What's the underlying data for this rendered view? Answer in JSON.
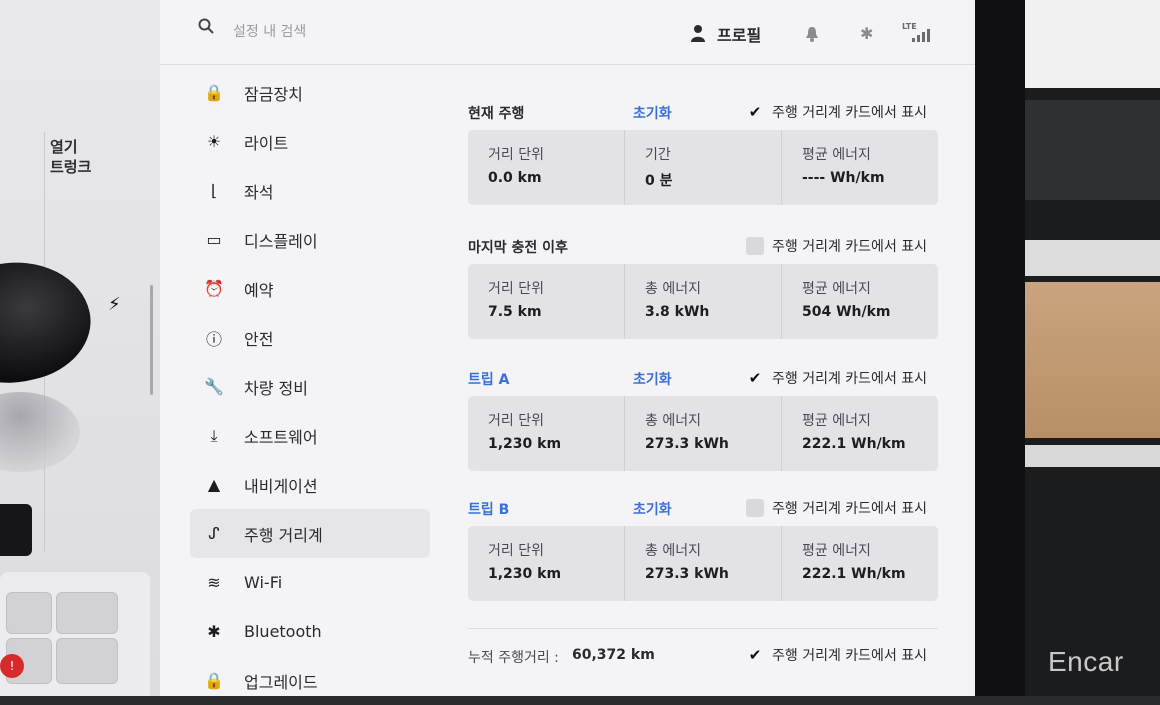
{
  "car_panel": {
    "trunk_label_line1": "열기",
    "trunk_label_line2": "트렁크",
    "seat_warning_icon": "!"
  },
  "header": {
    "search_placeholder": "설정 내 검색",
    "profile_label": "프로필",
    "lte_label": "LTE"
  },
  "sidebar": {
    "items": [
      {
        "label": "잠금장치",
        "icon": "lock-icon",
        "glyph": "🔒"
      },
      {
        "label": "라이트",
        "icon": "light-icon",
        "glyph": "☀"
      },
      {
        "label": "좌석",
        "icon": "seat-icon",
        "glyph": "⌊"
      },
      {
        "label": "디스플레이",
        "icon": "display-icon",
        "glyph": "▭"
      },
      {
        "label": "예약",
        "icon": "alarm-icon",
        "glyph": "⏰"
      },
      {
        "label": "안전",
        "icon": "safety-icon",
        "glyph": "ⓘ"
      },
      {
        "label": "차량 정비",
        "icon": "wrench-icon",
        "glyph": "🔧"
      },
      {
        "label": "소프트웨어",
        "icon": "download-icon",
        "glyph": "⤓"
      },
      {
        "label": "내비게이션",
        "icon": "navigation-icon",
        "glyph": "▲"
      },
      {
        "label": "주행 거리계",
        "icon": "trip-icon",
        "glyph": "ᔑ",
        "active": true
      },
      {
        "label": "Wi-Fi",
        "icon": "wifi-icon",
        "glyph": "≋"
      },
      {
        "label": "Bluetooth",
        "icon": "bluetooth-icon",
        "glyph": "✱"
      },
      {
        "label": "업그레이드",
        "icon": "upgrade-icon",
        "glyph": "🔒"
      }
    ]
  },
  "sections": {
    "current_trip": {
      "title": "현재 주행",
      "reset_label": "초기화",
      "show_label": "주행 거리계 카드에서 표시",
      "show_checked": true,
      "cells": [
        {
          "label": "거리 단위",
          "value": "0.0 km"
        },
        {
          "label": "기간",
          "value": "0 분"
        },
        {
          "label": "평균 에너지",
          "value": "---- Wh/km"
        }
      ]
    },
    "since_charge": {
      "title": "마지막 충전 이후",
      "show_label": "주행 거리계 카드에서 표시",
      "show_checked": false,
      "cells": [
        {
          "label": "거리 단위",
          "value": "7.5 km"
        },
        {
          "label": "총 에너지",
          "value": "3.8 kWh"
        },
        {
          "label": "평균 에너지",
          "value": "504 Wh/km"
        }
      ]
    },
    "trip_a": {
      "title": "트립 A",
      "reset_label": "초기화",
      "show_label": "주행 거리계 카드에서 표시",
      "show_checked": true,
      "cells": [
        {
          "label": "거리 단위",
          "value": "1,230 km"
        },
        {
          "label": "총 에너지",
          "value": "273.3 kWh"
        },
        {
          "label": "평균 에너지",
          "value": "222.1 Wh/km"
        }
      ]
    },
    "trip_b": {
      "title": "트립 B",
      "reset_label": "초기화",
      "show_label": "주행 거리계 카드에서 표시",
      "show_checked": false,
      "cells": [
        {
          "label": "거리 단위",
          "value": "1,230 km"
        },
        {
          "label": "총 에너지",
          "value": "273.3 kWh"
        },
        {
          "label": "평균 에너지",
          "value": "222.1 Wh/km"
        }
      ]
    }
  },
  "odometer": {
    "label": "누적 주행거리 :",
    "value": "60,372 km",
    "show_label": "주행 거리계 카드에서 표시",
    "show_checked": true
  },
  "watermark": "Encar",
  "colors": {
    "accent": "#3a6fd8",
    "background": "#f4f4f6",
    "card": "#e3e3e7"
  }
}
